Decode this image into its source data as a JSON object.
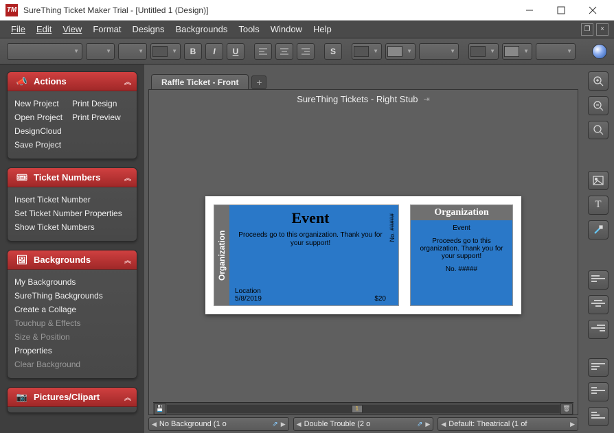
{
  "titlebar": {
    "logo": "TM",
    "title": "SureThing Ticket Maker Trial - [Untitled 1 (Design)]"
  },
  "menus": [
    "File",
    "Edit",
    "View",
    "Format",
    "Designs",
    "Backgrounds",
    "Tools",
    "Window",
    "Help"
  ],
  "toolbar": {
    "font_placeholder": "",
    "bold": "B",
    "italic": "I",
    "underline": "U",
    "shadow": "S"
  },
  "sidebar": {
    "actions": {
      "title": "Actions",
      "links": [
        "New Project",
        "Print Design",
        "Open Project",
        "Print Preview",
        "DesignCloud",
        "",
        "Save Project",
        ""
      ]
    },
    "ticketnums": {
      "title": "Ticket Numbers",
      "links": [
        "Insert Ticket Number",
        "Set Ticket Number Properties",
        "Show Ticket Numbers"
      ]
    },
    "backgrounds": {
      "title": "Backgrounds",
      "links": [
        {
          "t": "My Backgrounds",
          "dim": false
        },
        {
          "t": "SureThing Backgrounds",
          "dim": false
        },
        {
          "t": "Create a Collage",
          "dim": false
        },
        {
          "t": "Touchup & Effects",
          "dim": true
        },
        {
          "t": "Size & Position",
          "dim": true
        },
        {
          "t": "Properties",
          "dim": false
        },
        {
          "t": "Clear Background",
          "dim": true
        }
      ]
    },
    "clipart": {
      "title": "Pictures/Clipart"
    }
  },
  "tabs": {
    "active": "Raffle Ticket - Front"
  },
  "canvas": {
    "title": "SureThing Tickets - Right Stub"
  },
  "ticket": {
    "org_strip": "Organization",
    "event_title": "Event",
    "desc": "Proceeds go to this organization. Thank you for your support!",
    "location_label": "Location",
    "date": "5/8/2019",
    "price": "$20",
    "number": "No. #####",
    "stub_org": "Organization",
    "stub_event": "Event",
    "stub_desc": "Proceeds go to this organization. Thank you for your support!",
    "stub_number": "No. #####"
  },
  "hscroll": {
    "page": "1"
  },
  "selectors": {
    "bg": "No Background (1 o",
    "layout": "Double Trouble (2 o",
    "template": "Default: Theatrical (1 of"
  }
}
